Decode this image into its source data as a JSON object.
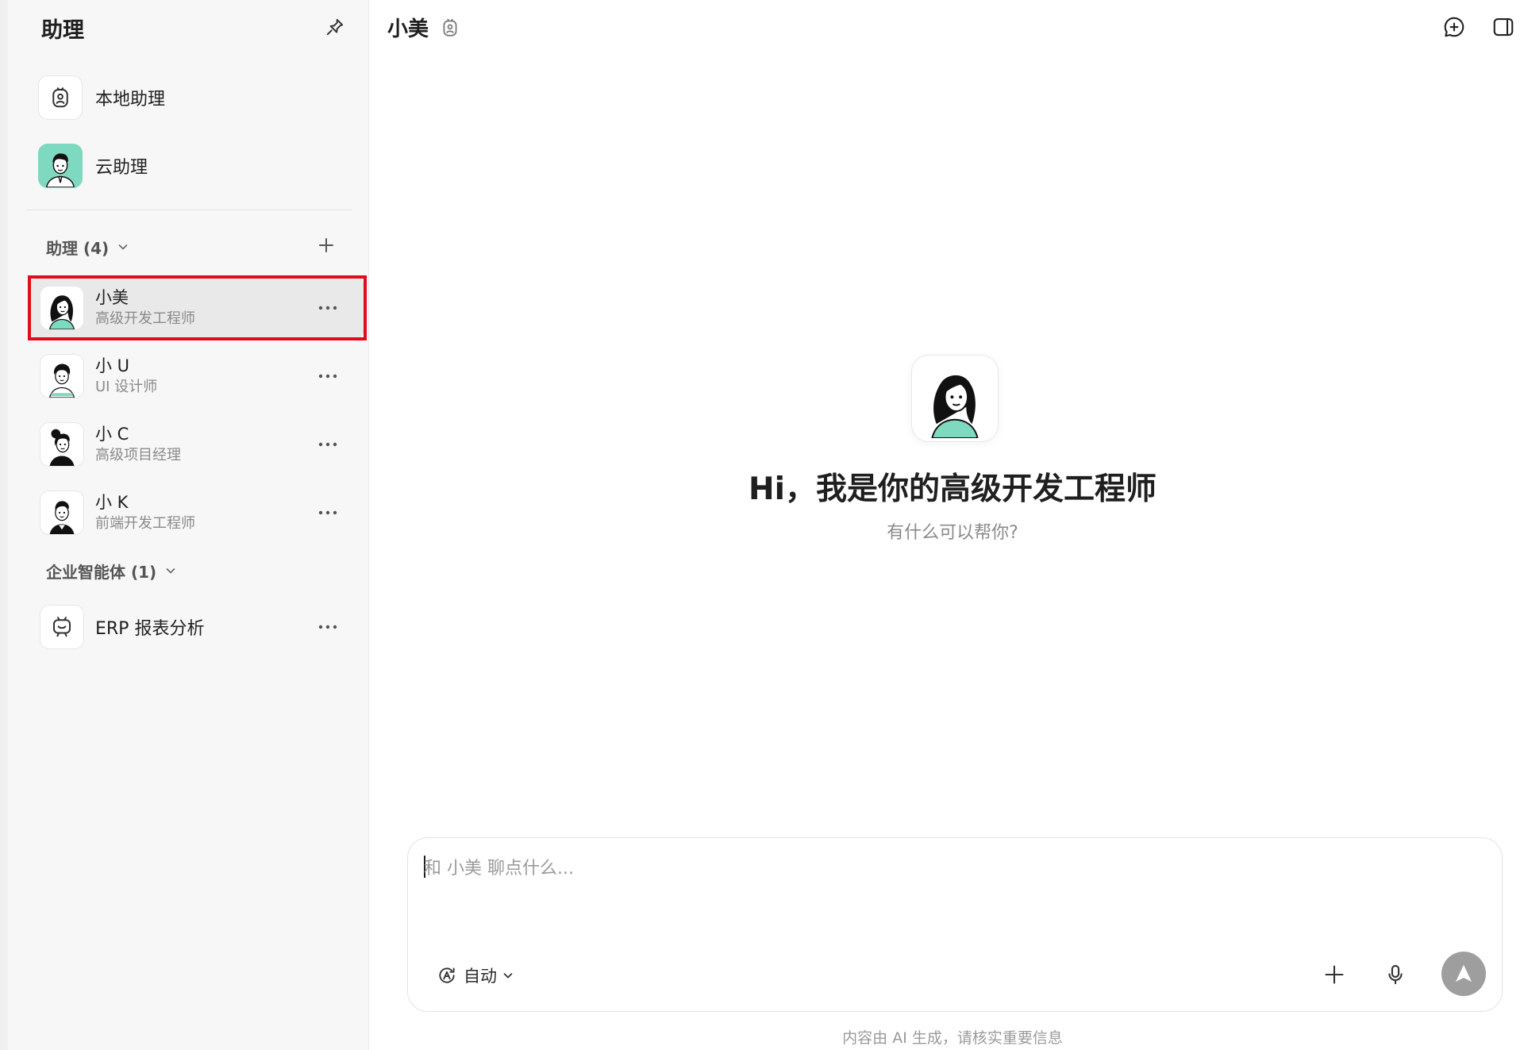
{
  "sidebar": {
    "title": "助理",
    "top_items": [
      {
        "label": "本地助理",
        "icon": "robot-badge-icon"
      },
      {
        "label": "云助理",
        "icon": "avatar-man"
      }
    ],
    "group_assistants": {
      "label": "助理 (4)"
    },
    "assistants": [
      {
        "name": "小美",
        "desc": "高级开发工程师",
        "active": true
      },
      {
        "name": "小 U",
        "desc": "UI 设计师",
        "active": false
      },
      {
        "name": "小 C",
        "desc": "高级项目经理",
        "active": false
      },
      {
        "name": "小 K",
        "desc": "前端开发工程师",
        "active": false
      }
    ],
    "group_enterprise": {
      "label": "企业智能体 (1)"
    },
    "enterprise_agents": [
      {
        "name": "ERP 报表分析",
        "icon": "bot-chat-icon"
      }
    ]
  },
  "chat": {
    "title": "小美",
    "greeting": "Hi，我是你的高级开发工程师",
    "subtitle": "有什么可以帮你?",
    "input_placeholder": "和 小美 聊点什么...",
    "mode_label": "自动",
    "disclaimer": "内容由 AI 生成，请核实重要信息"
  },
  "colors": {
    "highlight_border": "#e00b1c",
    "avatar_accent": "#7fd9c0",
    "send_button": "#9e9e9e"
  }
}
